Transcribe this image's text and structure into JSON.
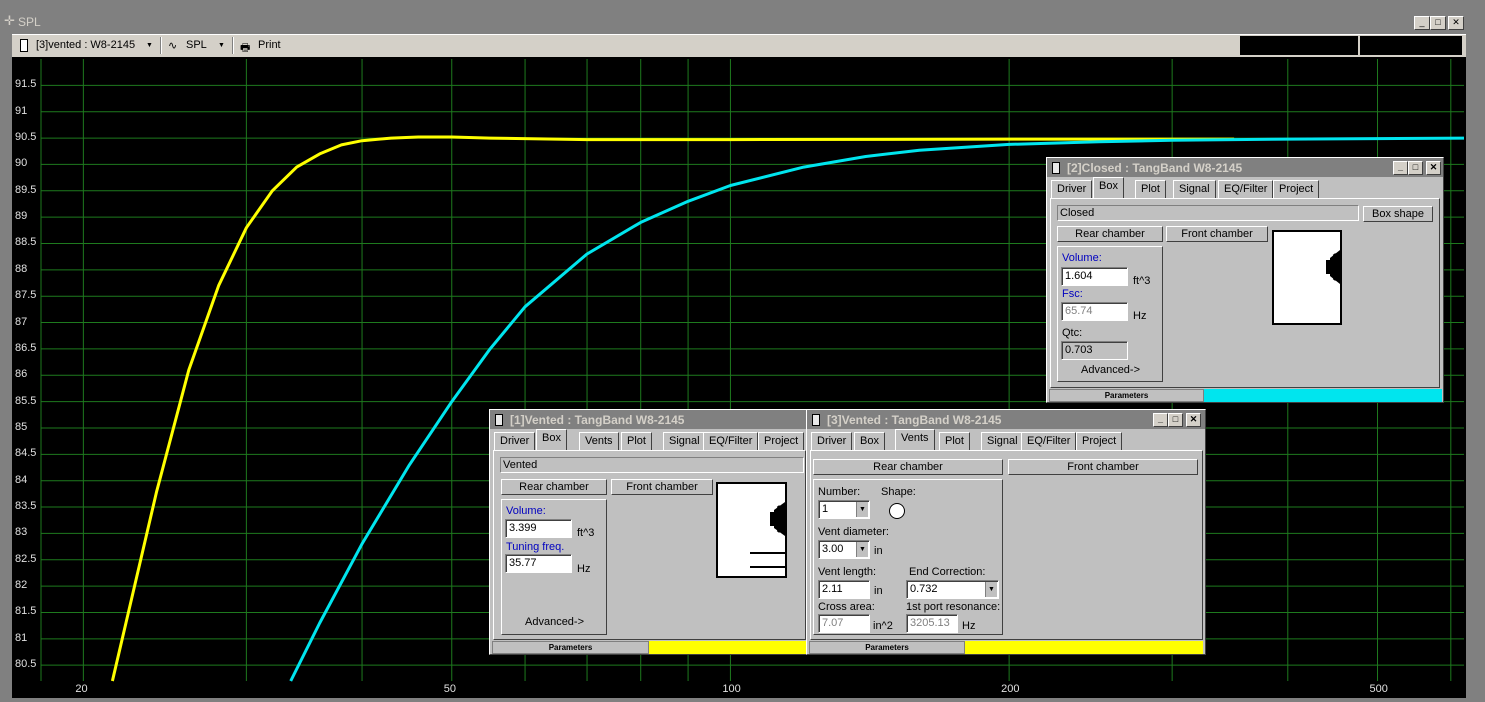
{
  "window": {
    "title": "SPL"
  },
  "toolbar": {
    "project": "[3]vented : W8-2145",
    "mode": "SPL",
    "print": "Print"
  },
  "axes": {
    "y_ticks": [
      "91.5",
      "91",
      "90.5",
      "90",
      "89.5",
      "89",
      "88.5",
      "88",
      "87.5",
      "87",
      "86.5",
      "86",
      "85.5",
      "85",
      "84.5",
      "84",
      "83.5",
      "83",
      "82.5",
      "82",
      "81.5",
      "81",
      "80.5"
    ],
    "x_ticks": [
      "20",
      "50",
      "100",
      "200",
      "500"
    ]
  },
  "chart_data": {
    "type": "line",
    "x_scale": "log",
    "xlim": [
      18,
      620
    ],
    "ylim": [
      80.2,
      92.0
    ],
    "series": [
      {
        "color": "#ffff00",
        "x": [
          21.5,
          24,
          26,
          28,
          30,
          32,
          34,
          36,
          38,
          40,
          43,
          46,
          50,
          55,
          70,
          100,
          200,
          350
        ],
        "y": [
          80.2,
          83.8,
          86.1,
          87.7,
          88.8,
          89.5,
          89.95,
          90.2,
          90.37,
          90.45,
          90.5,
          90.52,
          90.52,
          90.5,
          90.47,
          90.47,
          90.48,
          90.48
        ]
      },
      {
        "color": "#00e5ee",
        "x": [
          33.5,
          36,
          40,
          45,
          50,
          55,
          60,
          70,
          80,
          90,
          100,
          120,
          140,
          160,
          200,
          250,
          300,
          400,
          620
        ],
        "y": [
          80.2,
          81.3,
          82.8,
          84.3,
          85.5,
          86.5,
          87.3,
          88.3,
          88.9,
          89.3,
          89.6,
          89.95,
          90.15,
          90.27,
          90.38,
          90.43,
          90.46,
          90.48,
          90.5
        ]
      }
    ]
  },
  "dlg_closed": {
    "title": "[2]Closed : TangBand W8-2145",
    "tabs": [
      "Driver",
      "Box",
      "Plot",
      "Signal",
      "EQ/Filter",
      "Project"
    ],
    "box_type": "Closed",
    "box_shape": "Box shape",
    "rear": "Rear chamber",
    "front": "Front chamber",
    "volume_label": "Volume:",
    "volume": "1.604",
    "volume_unit": "ft^3",
    "fsc_label": "Fsc:",
    "fsc": "65.74",
    "fsc_unit": "Hz",
    "qtc_label": "Qtc:",
    "qtc": "0.703",
    "advanced": "Advanced->",
    "status": "Parameters",
    "status_color": "#00e5ee"
  },
  "dlg_vented1": {
    "title": "[1]Vented : TangBand W8-2145",
    "tabs": [
      "Driver",
      "Box",
      "Vents",
      "Plot",
      "Signal",
      "EQ/Filter",
      "Project"
    ],
    "box_type": "Vented",
    "rear": "Rear chamber",
    "front": "Front chamber",
    "volume_label": "Volume:",
    "volume": "3.399",
    "volume_unit": "ft^3",
    "tuning_label": "Tuning freq.",
    "tuning": "35.77",
    "tuning_unit": "Hz",
    "advanced": "Advanced->",
    "status": "Parameters",
    "status_color": "#ffff00"
  },
  "dlg_vented3": {
    "title": "[3]Vented : TangBand W8-2145",
    "tabs": [
      "Driver",
      "Box",
      "Vents",
      "Plot",
      "Signal",
      "EQ/Filter",
      "Project"
    ],
    "rear": "Rear chamber",
    "front": "Front chamber",
    "number_label": "Number:",
    "number": "1",
    "shape_label": "Shape:",
    "diam_label": "Vent diameter:",
    "diam": "3.00",
    "diam_unit": "in",
    "length_label": "Vent length:",
    "length": "2.11",
    "length_unit": "in",
    "endcorr_label": "End Correction:",
    "endcorr": "0.732",
    "area_label": "Cross area:",
    "area": "7.07",
    "area_unit": "in^2",
    "res_label": "1st port resonance:",
    "res": "3205.13",
    "res_unit": "Hz",
    "status": "Parameters",
    "status_color": "#ffff00"
  }
}
